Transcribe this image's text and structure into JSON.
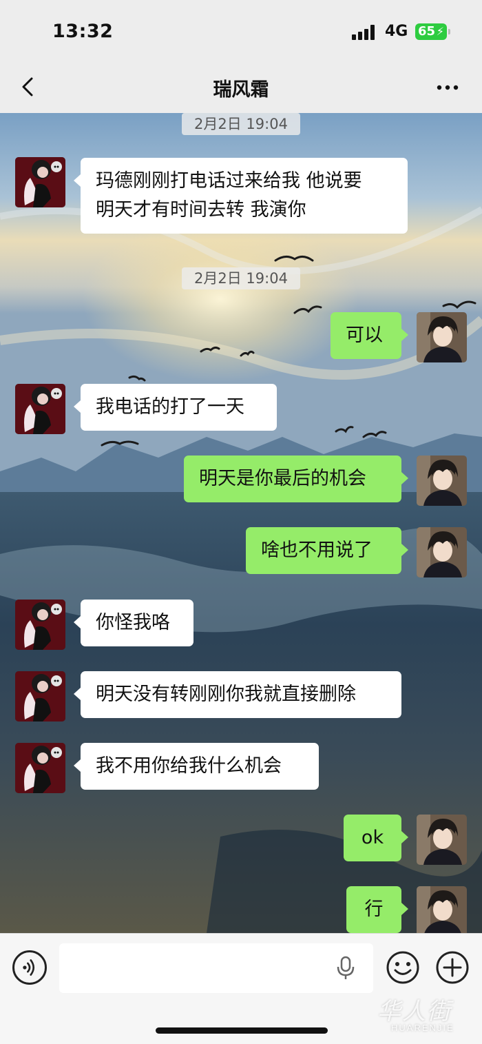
{
  "status_bar": {
    "time": "13:32",
    "network": "4G",
    "battery": "65"
  },
  "header": {
    "title": "瑞风霜"
  },
  "messages": [
    {
      "type": "timestamp",
      "text": "2月2日 19:04"
    },
    {
      "type": "message",
      "side": "in",
      "lines": [
        "玛德刚刚打电话过来给我 他说要",
        "明天才有时间去转 我演你"
      ]
    },
    {
      "type": "timestamp",
      "text": "2月2日 19:04"
    },
    {
      "type": "message",
      "side": "out",
      "lines": [
        "可以"
      ]
    },
    {
      "type": "message",
      "side": "in",
      "lines": [
        "我电话的打了一天"
      ]
    },
    {
      "type": "message",
      "side": "out",
      "lines": [
        "明天是你最后的机会"
      ]
    },
    {
      "type": "message",
      "side": "out",
      "lines": [
        "啥也不用说了"
      ]
    },
    {
      "type": "message",
      "side": "in",
      "lines": [
        "你怪我咯"
      ]
    },
    {
      "type": "message",
      "side": "in",
      "lines": [
        "明天没有转刚刚你我就直接删除"
      ]
    },
    {
      "type": "message",
      "side": "in",
      "lines": [
        "我不用你给我什么机会"
      ]
    },
    {
      "type": "message",
      "side": "out",
      "lines": [
        "ok"
      ]
    },
    {
      "type": "message",
      "side": "out",
      "lines": [
        "行"
      ]
    }
  ],
  "input_bar": {
    "placeholder": ""
  },
  "watermark": {
    "main": "华人街",
    "sub": "HUARENJIE"
  },
  "colors": {
    "outgoing_bubble": "#95ec69",
    "incoming_bubble": "#ffffff",
    "battery": "#2ecc40"
  },
  "icons": [
    "back-arrow-icon",
    "more-dots-icon",
    "voice-icon",
    "mic-icon",
    "emoji-icon",
    "plus-icon"
  ]
}
